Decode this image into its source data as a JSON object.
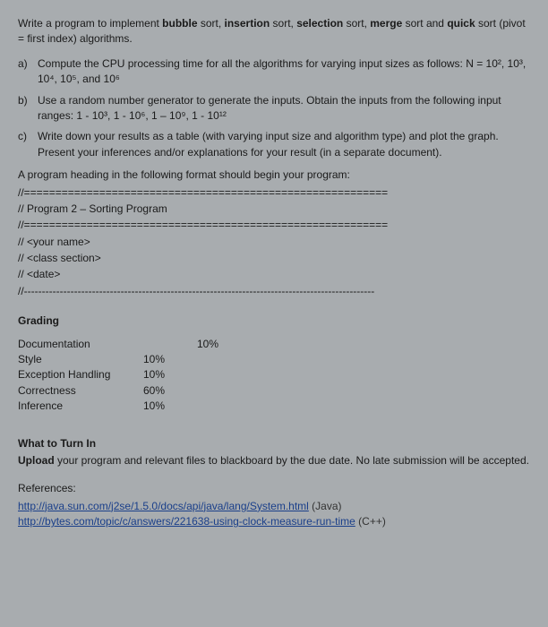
{
  "intro": {
    "p1_a": "Write a program to implement ",
    "p1_bold1": "bubble",
    "p1_b": " sort, ",
    "p1_bold2": "insertion",
    "p1_c": " sort, ",
    "p1_bold3": "selection",
    "p1_d": " sort, ",
    "p1_bold4": "merge",
    "p1_e": " sort and ",
    "p1_bold5": "quick",
    "p1_f": " sort (pivot = first index) algorithms."
  },
  "items": {
    "a_lbl": "a)",
    "a_txt": "Compute the CPU processing time for all the algorithms for varying input sizes as follows:  N = 10², 10³, 10⁴, 10⁵, and 10⁶",
    "b_lbl": "b)",
    "b_txt": "Use a random number generator to generate the inputs. Obtain the inputs from the following input ranges: 1 - 10³, 1 - 10⁶, 1 – 10⁹, 1 - 10¹²",
    "c_lbl": "c)",
    "c_txt": "Write down your results as a table (with varying input size and algorithm type) and plot the graph. Present your inferences and/or explanations for your result (in a separate document)."
  },
  "heading_line": "A program heading in the following format should begin your program:",
  "code": {
    "l1": "//==========================================================",
    "l2": "//   Program 2 – Sorting Program",
    "l3": "//==========================================================",
    "l4": "// <your name>",
    "l5": "// <class section>",
    "l6": "// <date>",
    "l7": "//--------------------------------------------------------------------------------------------------"
  },
  "grading": {
    "title": "Grading",
    "rows": {
      "doc_lab": "Documentation",
      "doc_val": "10%",
      "style_lab": "Style",
      "style_val": "10%",
      "exc_lab": "Exception Handling",
      "exc_val": "10%",
      "cor_lab": "Correctness",
      "cor_val": "60%",
      "inf_lab": "Inference",
      "inf_val": "10%"
    }
  },
  "turnin": {
    "title": "What to Turn In",
    "upload_bold": "Upload",
    "upload_rest": " your program and relevant files to blackboard by the due date. No late submission will be accepted."
  },
  "refs": {
    "title": "References:",
    "link1": "http://java.sun.com/j2se/1.5.0/docs/api/java/lang/System.html",
    "link1_paren": " (Java)",
    "link2": "http://bytes.com/topic/c/answers/221638-using-clock-measure-run-time",
    "link2_paren": " (C++)"
  }
}
